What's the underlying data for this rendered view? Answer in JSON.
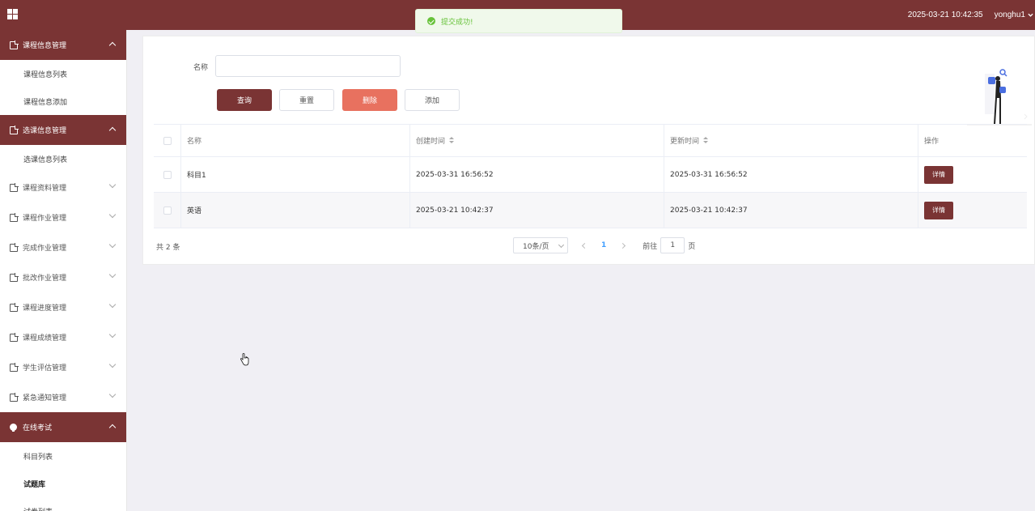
{
  "header": {
    "datetime": "2025-03-21 10:42:35",
    "username": "yonghu1"
  },
  "toast": {
    "message": "提交成功!"
  },
  "sidebar": {
    "groups": [
      {
        "label": "课程信息管理",
        "active": true,
        "items": [
          "课程信息列表",
          "课程信息添加"
        ]
      },
      {
        "label": "选课信息管理",
        "active": true,
        "items": [
          "选课信息列表"
        ]
      },
      {
        "label": "课程资料管理",
        "active": false
      },
      {
        "label": "课程作业管理",
        "active": false
      },
      {
        "label": "完成作业管理",
        "active": false
      },
      {
        "label": "批改作业管理",
        "active": false
      },
      {
        "label": "课程进度管理",
        "active": false
      },
      {
        "label": "课程成绩管理",
        "active": false
      },
      {
        "label": "学生评估管理",
        "active": false
      },
      {
        "label": "紧急通知管理",
        "active": false
      },
      {
        "label": "在线考试",
        "active": true,
        "items": [
          "科目列表",
          "试题库",
          "试卷列表"
        ]
      }
    ]
  },
  "search": {
    "label": "名称",
    "value": ""
  },
  "buttons": {
    "query": "查询",
    "reset": "重置",
    "delete": "删除",
    "add": "添加"
  },
  "table": {
    "headers": [
      "名称",
      "创建时间",
      "更新时间",
      "操作"
    ],
    "rows": [
      {
        "name": "科目1",
        "created": "2025-03-31 16:56:52",
        "updated": "2025-03-31 16:56:52",
        "action": "详情"
      },
      {
        "name": "英语",
        "created": "2025-03-21 10:42:37",
        "updated": "2025-03-21 10:42:37",
        "action": "详情"
      }
    ]
  },
  "pagination": {
    "total": "共 2 条",
    "page_size": "10条/页",
    "current_page": "1",
    "goto_label": "前往",
    "goto_value": "1",
    "page_suffix": "页"
  },
  "colors": {
    "primary": "#7a3434",
    "danger": "#e8715f",
    "success": "#67c23a",
    "link": "#409eff"
  }
}
